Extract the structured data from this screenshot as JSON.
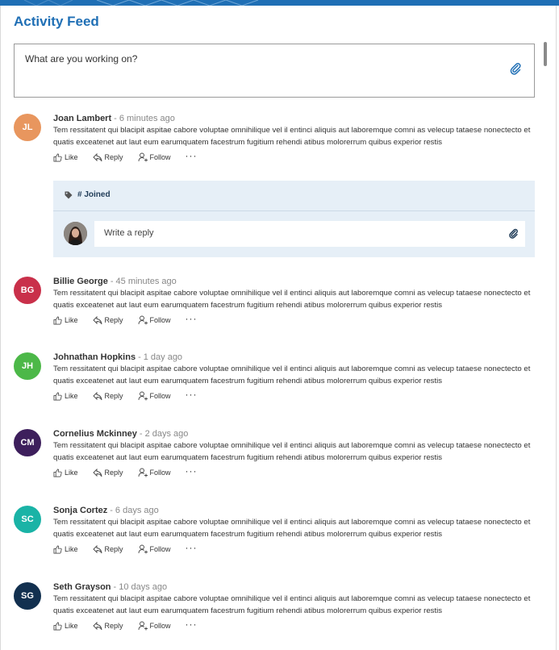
{
  "feed": {
    "title": "Activity Feed",
    "composer_placeholder": "What are you working on?",
    "attach_icon": "paperclip-icon"
  },
  "actions": {
    "like": "Like",
    "reply": "Reply",
    "follow": "Follow",
    "more": "···"
  },
  "colors": {
    "accent": "#1f6fb5"
  },
  "posts": [
    {
      "initials": "JL",
      "name": "Joan  Lambert",
      "time": "6 minutes ago",
      "avatar_color": "#e8965e",
      "text": "Tem ressitatent qui blacipit aspitae cabore voluptae omnihilique vel il entinci aliquis aut laboremque comni as velecup tataese nonectecto et quatis exceatenet aut laut eum earumquatem facestrum fugitium rehendi atibus molorerrum quibus experior restis"
    },
    {
      "initials": "BG",
      "name": "Billie George",
      "time": "45 minutes ago",
      "avatar_color": "#c9304a",
      "text": "Tem ressitatent qui blacipit aspitae cabore voluptae omnihilique vel il entinci aliquis aut laboremque comni as velecup tataese nonectecto et quatis exceatenet aut laut eum earumquatem facestrum fugitium rehendi atibus molorerrum quibus experior restis"
    },
    {
      "initials": "JH",
      "name": "Johnathan Hopkins",
      "time": "1 day ago",
      "avatar_color": "#4cb848",
      "text": "Tem ressitatent qui blacipit aspitae cabore voluptae omnihilique vel il entinci aliquis aut laboremque comni as velecup tataese nonectecto et quatis exceatenet aut laut eum earumquatem facestrum fugitium rehendi atibus molorerrum quibus experior restis"
    },
    {
      "initials": "CM",
      "name": "Cornelius Mckinney",
      "time": "2 days ago",
      "avatar_color": "#3d1f5c",
      "text": "Tem ressitatent qui blacipit aspitae cabore voluptae omnihilique vel il entinci aliquis aut laboremque comni as velecup tataese nonectecto et quatis exceatenet aut laut eum earumquatem facestrum fugitium rehendi atibus molorerrum quibus experior restis"
    },
    {
      "initials": "SC",
      "name": "Sonja Cortez",
      "time": "6 days ago",
      "avatar_color": "#1ab3a6",
      "text": "Tem ressitatent qui blacipit aspitae cabore voluptae omnihilique vel il entinci aliquis aut laboremque comni as velecup tataese nonectecto et quatis exceatenet aut laut eum earumquatem facestrum fugitium rehendi atibus molorerrum quibus experior restis"
    },
    {
      "initials": "SG",
      "name": "Seth Grayson",
      "time": "10 days ago",
      "avatar_color": "#12304f",
      "text": "Tem ressitatent qui blacipit aspitae cabore voluptae omnihilique vel il entinci aliquis aut laboremque comni as velecup tataese nonectecto et quatis exceatenet aut laut eum earumquatem facestrum fugitium rehendi atibus molorerrum quibus experior restis"
    }
  ],
  "reply_panel": {
    "tag": "# Joined",
    "tag_icon": "tag-icon",
    "reply_placeholder": "Write a reply"
  }
}
